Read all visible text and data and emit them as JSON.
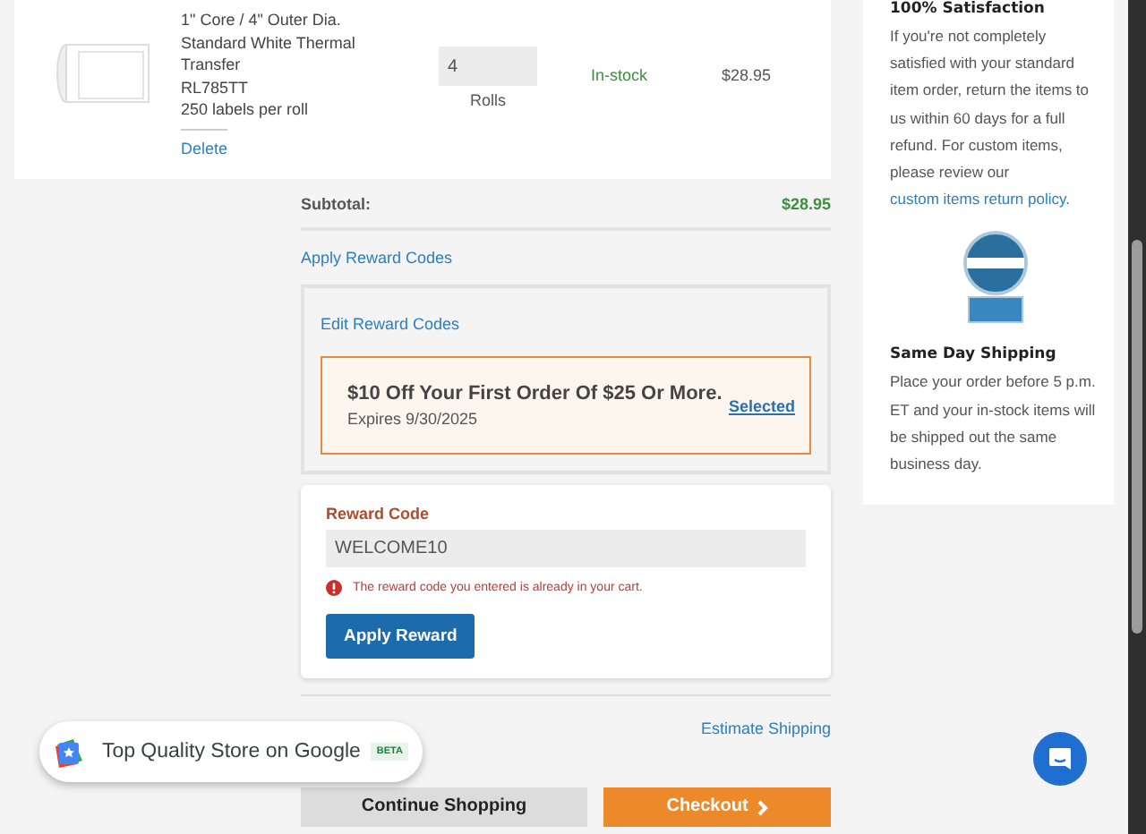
{
  "product": {
    "description_lines": [
      "1\" Core / 4\" Outer Dia.",
      "Standard White Thermal",
      "Transfer",
      "RL785TT",
      "250 labels per roll"
    ],
    "delete_link": "Delete",
    "quantity": "4",
    "unit": "Rolls",
    "stock": "In-stock",
    "price": "$28.95"
  },
  "subtotal": {
    "label": "Subtotal:",
    "value": "$28.95"
  },
  "apply_reward_link": "Apply Reward Codes",
  "rewards_panel": {
    "edit_link": "Edit Reward Codes",
    "offers": [
      {
        "title": "$10 Off Your First Order Of $25 Or More.",
        "expires": "Expires 9/30/2025",
        "status": "Selected",
        "selected": true
      }
    ]
  },
  "reward_form": {
    "label": "Reward Code",
    "value": "WELCOME10",
    "error": "The reward code you entered is already in your cart.",
    "button": "Apply Reward"
  },
  "estimate_shipping": "Estimate Shipping",
  "buttons": [
    {
      "label": "Continue Shopping",
      "kind": "secondary"
    },
    {
      "label": "Checkout",
      "kind": "primary"
    }
  ],
  "sidebar": {
    "sections": [
      {
        "heading": "100% Satisfaction",
        "body": "If you're not completely satisfied with your standard item order, return the items to us within 60 days for a full refund. For custom items, please review our",
        "link": "custom items return policy",
        "after": "."
      },
      {
        "heading": "Same Day Shipping",
        "body": "Place your order before 5 p.m. ET and your in-stock items will be shipped out the same business day."
      }
    ]
  },
  "store_badge": {
    "text": "Top Quality Store on Google",
    "tag": "BETA"
  }
}
